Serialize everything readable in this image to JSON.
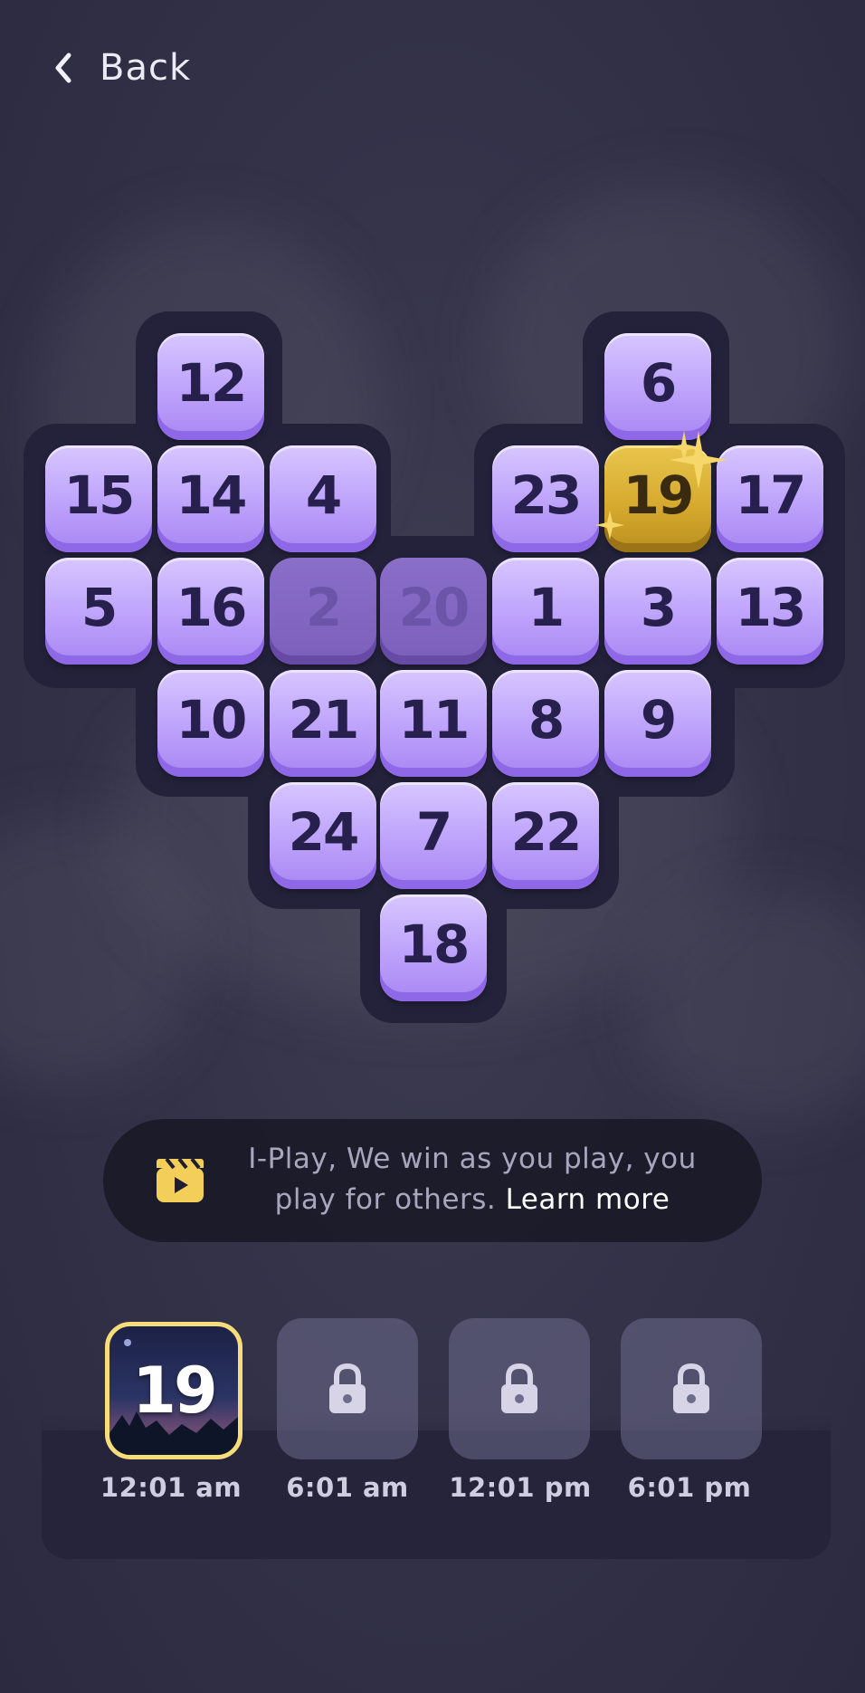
{
  "header": {
    "back_label": "Back"
  },
  "board": {
    "tiles": [
      {
        "label": "12",
        "state": "normal"
      },
      {
        "label": "6",
        "state": "normal"
      },
      {
        "label": "15",
        "state": "normal"
      },
      {
        "label": "14",
        "state": "normal"
      },
      {
        "label": "4",
        "state": "normal"
      },
      {
        "label": "23",
        "state": "normal"
      },
      {
        "label": "19",
        "state": "highlighted"
      },
      {
        "label": "17",
        "state": "normal"
      },
      {
        "label": "5",
        "state": "normal"
      },
      {
        "label": "16",
        "state": "normal"
      },
      {
        "label": "2",
        "state": "dimmed"
      },
      {
        "label": "20",
        "state": "dimmed"
      },
      {
        "label": "1",
        "state": "normal"
      },
      {
        "label": "3",
        "state": "normal"
      },
      {
        "label": "13",
        "state": "normal"
      },
      {
        "label": "10",
        "state": "normal"
      },
      {
        "label": "21",
        "state": "normal"
      },
      {
        "label": "11",
        "state": "normal"
      },
      {
        "label": "8",
        "state": "normal"
      },
      {
        "label": "9",
        "state": "normal"
      },
      {
        "label": "24",
        "state": "normal"
      },
      {
        "label": "7",
        "state": "normal"
      },
      {
        "label": "22",
        "state": "normal"
      },
      {
        "label": "18",
        "state": "normal"
      }
    ]
  },
  "info_banner": {
    "icon": "clapperboard-play-icon",
    "text": "I-Play, We win as you play, you play for others.",
    "link_label": "Learn more"
  },
  "schedule": {
    "slots": [
      {
        "time": "12:01 am",
        "status": "unlocked",
        "number": "19"
      },
      {
        "time": "6:01 am",
        "status": "locked",
        "icon": "lock-icon"
      },
      {
        "time": "12:01 pm",
        "status": "locked",
        "icon": "lock-icon"
      },
      {
        "time": "6:01 pm",
        "status": "locked",
        "icon": "lock-icon"
      }
    ]
  },
  "colors": {
    "tile": "#c3a9fd",
    "tile_dimmed": "#8064c0",
    "tile_highlight": "#dcb43a",
    "selected_border": "#f6dd7a",
    "background": "#34334a"
  }
}
